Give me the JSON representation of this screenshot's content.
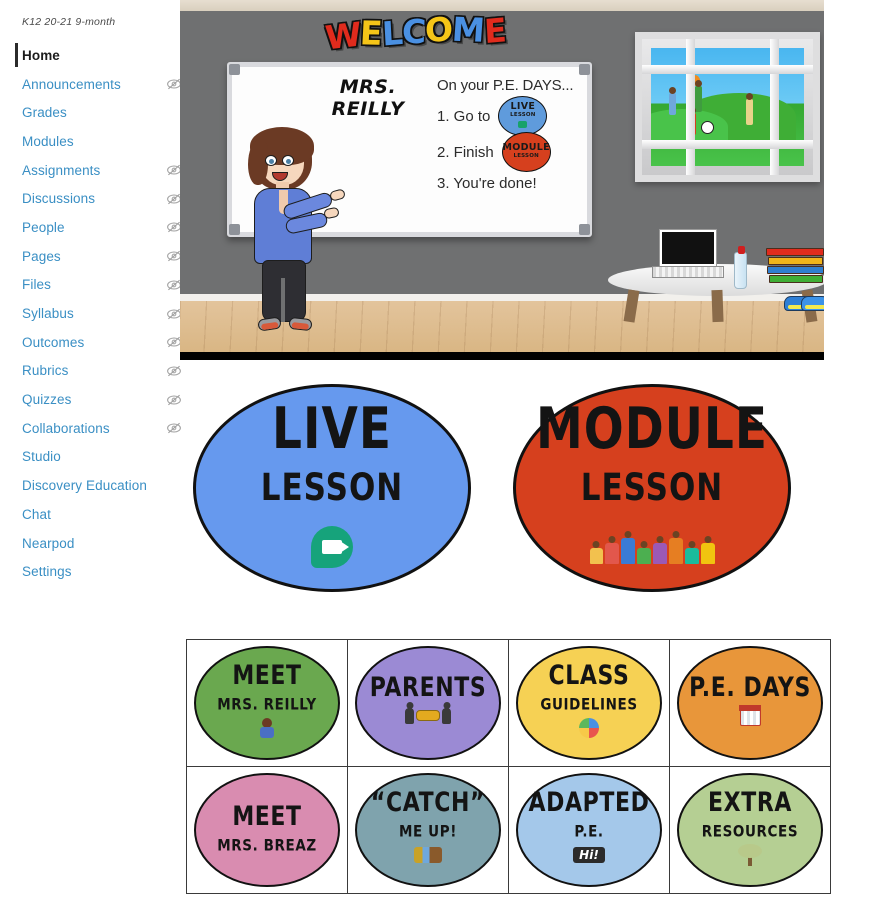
{
  "course": {
    "breadcrumb": "K12 20-21 9-month"
  },
  "sidebar": {
    "items": [
      {
        "label": "Home",
        "hidden": false,
        "active": true
      },
      {
        "label": "Announcements",
        "hidden": true,
        "active": false
      },
      {
        "label": "Grades",
        "hidden": false,
        "active": false
      },
      {
        "label": "Modules",
        "hidden": false,
        "active": false
      },
      {
        "label": "Assignments",
        "hidden": true,
        "active": false
      },
      {
        "label": "Discussions",
        "hidden": true,
        "active": false
      },
      {
        "label": "People",
        "hidden": true,
        "active": false
      },
      {
        "label": "Pages",
        "hidden": true,
        "active": false
      },
      {
        "label": "Files",
        "hidden": true,
        "active": false
      },
      {
        "label": "Syllabus",
        "hidden": true,
        "active": false
      },
      {
        "label": "Outcomes",
        "hidden": true,
        "active": false
      },
      {
        "label": "Rubrics",
        "hidden": true,
        "active": false
      },
      {
        "label": "Quizzes",
        "hidden": true,
        "active": false
      },
      {
        "label": "Collaborations",
        "hidden": true,
        "active": false
      },
      {
        "label": "Studio",
        "hidden": false,
        "active": false
      },
      {
        "label": "Discovery Education",
        "hidden": false,
        "active": false
      },
      {
        "label": "Chat",
        "hidden": false,
        "active": false
      },
      {
        "label": "Nearpod",
        "hidden": false,
        "active": false
      },
      {
        "label": "Settings",
        "hidden": false,
        "active": false
      }
    ],
    "hidden_icon_name": "eye-off-icon"
  },
  "banner": {
    "welcome_word": "WELCOME",
    "whiteboard": {
      "teacher_name_line1": "MRS.",
      "teacher_name_line2": "REILLY",
      "heading": "On your P.E. DAYS...",
      "step1_text": "1.  Go to",
      "step1_oval_line1": "LIVE",
      "step1_oval_line2": "LESSON",
      "step2_text": "2. Finish",
      "step2_oval_line1": "MODULE",
      "step2_oval_line2": "LESSON",
      "step3_text": "3. You're done!"
    }
  },
  "big_buttons": [
    {
      "line1": "LIVE",
      "line2": "LESSON",
      "color": "#6699ee",
      "icon": "google-meet-icon"
    },
    {
      "line1": "MODULE",
      "line2": "LESSON",
      "color": "#d6401e",
      "icon": "kids-playing-icon"
    }
  ],
  "tiles": [
    {
      "line1": "MEET",
      "line2": "MRS. REILLY",
      "color": "#6aa84f",
      "icon": "teacher-waving-icon"
    },
    {
      "line1": "PARENTS",
      "line2": "",
      "color": "#9b8ad4",
      "icon": "two-people-talking-icon"
    },
    {
      "line1": "CLASS",
      "line2": "GUIDELINES",
      "color": "#f6d154",
      "icon": "globe-icon"
    },
    {
      "line1": "P.E. DAYS",
      "line2": "",
      "color": "#e8963a",
      "icon": "calendar-icon"
    },
    {
      "line1": "MEET",
      "line2": "MRS. BREAZ",
      "color": "#d98cb0",
      "icon": "none"
    },
    {
      "line1": "“CATCH”",
      "line2": "ME UP!",
      "color": "#7fa3ad",
      "icon": "cleanup-clutter-icon"
    },
    {
      "line1": "ADAPTED",
      "line2": "P.E.",
      "color": "#a4c8ea",
      "icon": "hi-speech-bubble-icon"
    },
    {
      "line1": "EXTRA",
      "line2": "RESOURCES",
      "color": "#b5cf93",
      "icon": "tree-icon"
    }
  ]
}
